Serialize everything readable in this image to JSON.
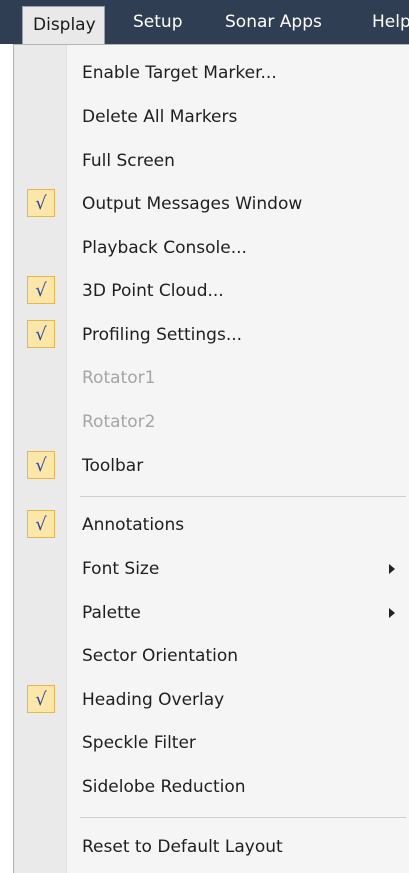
{
  "menubar": {
    "items": [
      "Display",
      "Setup",
      "Sonar Apps",
      "Help"
    ]
  },
  "menu": {
    "items": [
      {
        "label": "Enable Target Marker...",
        "checked": false,
        "enabled": true
      },
      {
        "label": "Delete All Markers",
        "checked": false,
        "enabled": true
      },
      {
        "label": "Full Screen",
        "checked": false,
        "enabled": true
      },
      {
        "label": "Output Messages Window",
        "checked": true,
        "enabled": true
      },
      {
        "label": "Playback Console...",
        "checked": false,
        "enabled": true
      },
      {
        "label": "3D Point Cloud...",
        "checked": true,
        "enabled": true
      },
      {
        "label": "Profiling Settings...",
        "checked": true,
        "enabled": true
      },
      {
        "label": "Rotator1",
        "checked": false,
        "enabled": false
      },
      {
        "label": "Rotator2",
        "checked": false,
        "enabled": false
      },
      {
        "label": "Toolbar",
        "checked": true,
        "enabled": true
      },
      {
        "label": "Annotations",
        "checked": true,
        "enabled": true
      },
      {
        "label": "Font Size",
        "checked": false,
        "enabled": true,
        "submenu": true
      },
      {
        "label": "Palette",
        "checked": false,
        "enabled": true,
        "submenu": true
      },
      {
        "label": "Sector Orientation",
        "checked": false,
        "enabled": true
      },
      {
        "label": "Heading Overlay",
        "checked": true,
        "enabled": true
      },
      {
        "label": "Speckle Filter",
        "checked": false,
        "enabled": true
      },
      {
        "label": "Sidelobe Reduction",
        "checked": false,
        "enabled": true
      },
      {
        "label": "Reset to Default Layout",
        "checked": false,
        "enabled": true
      }
    ],
    "check_glyph": "√",
    "colors": {
      "menubar_bg": "#2f3e53",
      "check_bg": "#fde7a8",
      "check_border": "#e7b64c",
      "check_mark": "#2a49a6",
      "disabled_text": "#a5a5a5"
    }
  }
}
